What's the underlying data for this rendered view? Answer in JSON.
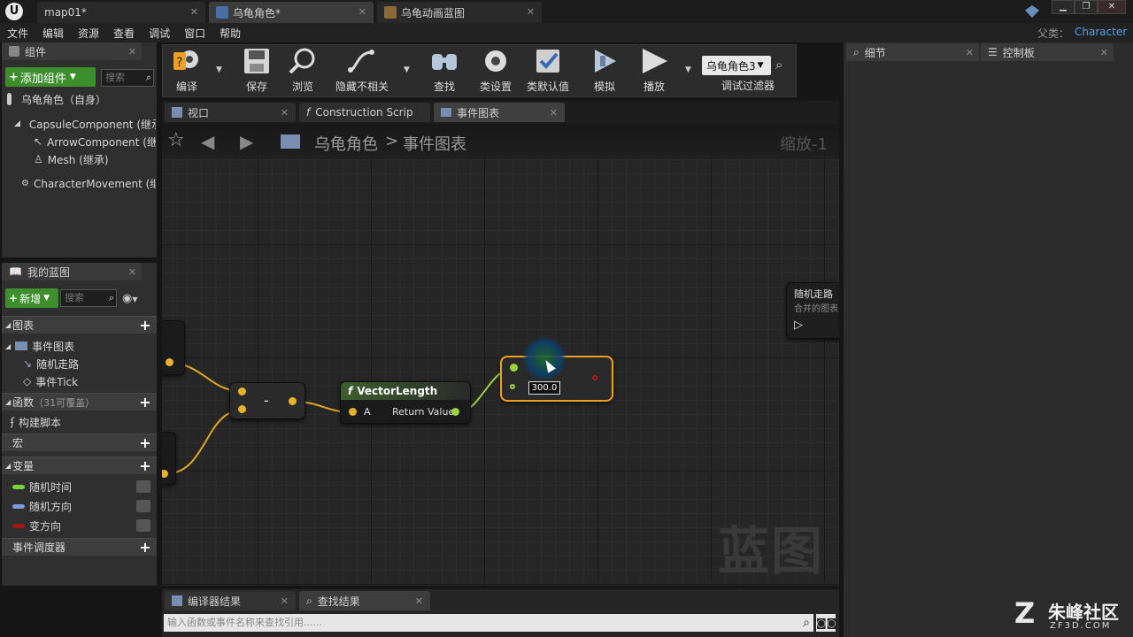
{
  "titlebar": {
    "tabs": [
      {
        "label": "map01*"
      },
      {
        "label": "乌龟角色*"
      },
      {
        "label": "乌龟动画蓝图"
      }
    ],
    "parent_class_label": "父类：",
    "parent_class_value": "Character"
  },
  "menu": [
    "文件",
    "编辑",
    "资源",
    "查看",
    "调试",
    "窗口",
    "帮助"
  ],
  "components_panel": {
    "tab_label": "组件",
    "add_button": "添加组件",
    "search_placeholder": "搜索",
    "root_item": "乌龟角色（自身）",
    "items": [
      {
        "label": "CapsuleComponent (继承"
      },
      {
        "label": "ArrowComponent (继承"
      },
      {
        "label": "Mesh (继承)"
      },
      {
        "label": "CharacterMovement (继承"
      }
    ]
  },
  "my_blueprint": {
    "tab_label": "我的蓝图",
    "new_button": "新增",
    "search_placeholder": "搜索",
    "graphs_header": "图表",
    "event_graph": "事件图表",
    "event_items": [
      "随机走路",
      "事件Tick"
    ],
    "functions_header": "函数",
    "functions_sub": "（31可覆盖）",
    "function_items": [
      "构建脚本"
    ],
    "macros_header": "宏",
    "variables_header": "变量",
    "variables": [
      {
        "label": "随机时间",
        "color": "#7bd13a"
      },
      {
        "label": "随机方向",
        "color": "#7c9bd8"
      },
      {
        "label": "变方向",
        "color": "#a01818"
      }
    ],
    "dispatchers_header": "事件调度器"
  },
  "toolbar": {
    "buttons": [
      "编译",
      "保存",
      "浏览",
      "隐藏不相关",
      "查找",
      "类设置",
      "类默认值",
      "模拟",
      "播放"
    ],
    "debug_object": "乌龟角色3",
    "debug_filter_label": "调试过滤器"
  },
  "editor_tabs": [
    {
      "label": "视口"
    },
    {
      "label": "Construction Scrip"
    },
    {
      "label": "事件图表"
    }
  ],
  "graph": {
    "breadcrumb_root": "乌龟角色",
    "breadcrumb_leaf": "事件图表",
    "zoom_label": "缩放-1",
    "watermark": "蓝图",
    "subtract_label": "-",
    "vector_length_title": "VectorLength",
    "pin_a": "A",
    "pin_return": "Return Value",
    "compare_value": "300.0",
    "random_walk_title": "随机走路",
    "random_walk_sub": "合并的图表"
  },
  "right_panels": {
    "details_tab": "细节",
    "palette_tab": "控制板"
  },
  "bottom": {
    "compiler_tab": "编译器结果",
    "find_tab": "查找结果",
    "find_placeholder": "输入函数或事件名称来查找引用......"
  },
  "site_watermark": {
    "name": "朱峰社区",
    "domain": "ZF3D.COM"
  }
}
